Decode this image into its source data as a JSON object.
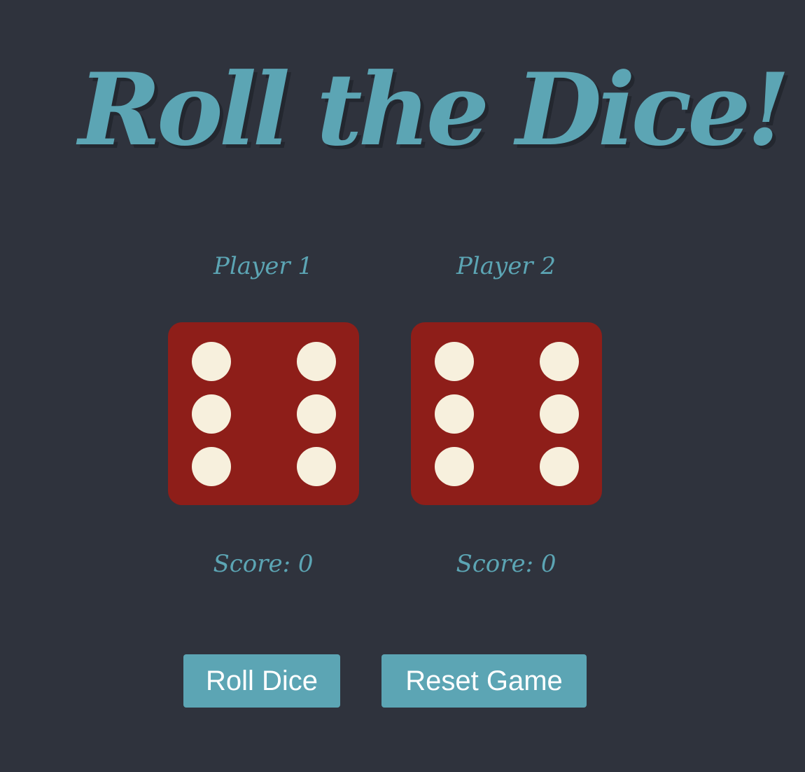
{
  "title": "Roll the Dice!",
  "players": [
    {
      "label": "Player 1",
      "score_text": "Score: 0",
      "die_value": 6
    },
    {
      "label": "Player 2",
      "score_text": "Score: 0",
      "die_value": 6
    }
  ],
  "buttons": {
    "roll": "Roll Dice",
    "reset": "Reset Game"
  },
  "colors": {
    "background": "#2f333d",
    "accent": "#5ca5b4",
    "die_face": "#8e1e19",
    "pip": "#f7f0dd"
  }
}
